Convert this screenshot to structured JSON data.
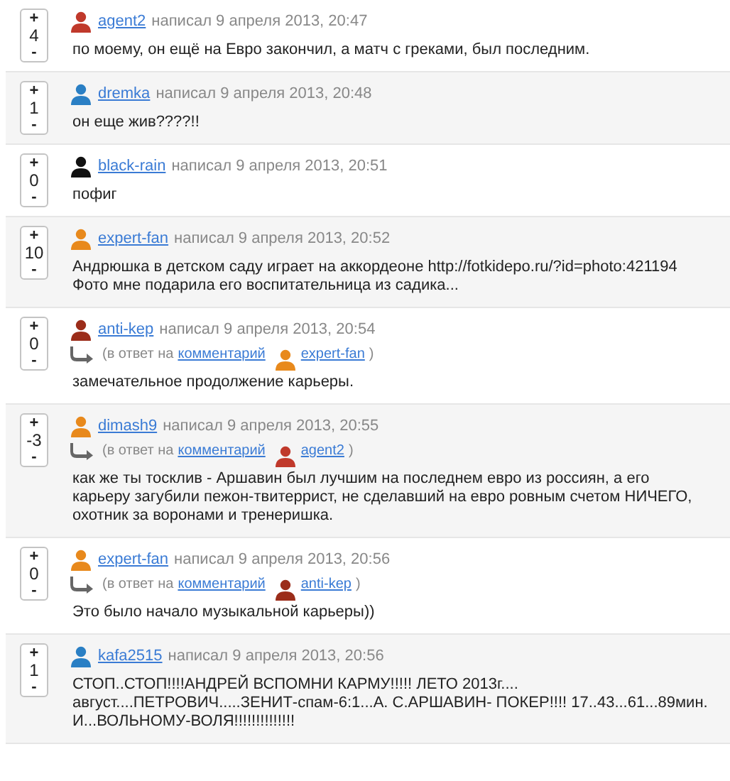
{
  "comments": [
    {
      "score": "4",
      "plus": "+",
      "minus": "-",
      "user": "agent2",
      "avatar": {
        "color": "#c0392b"
      },
      "meta": "написал 9 апреля 2013, 20:47",
      "text": "по моему, он ещё на Евро закончил, а матч с греками, был последним."
    },
    {
      "score": "1",
      "plus": "+",
      "minus": "-",
      "user": "dremka",
      "avatar": {
        "color": "#2a7fc4"
      },
      "meta": "написал 9 апреля 2013, 20:48",
      "text": "он еще жив????!!"
    },
    {
      "score": "0",
      "plus": "+",
      "minus": "-",
      "user": "black-rain",
      "avatar": {
        "color": "#111111"
      },
      "meta": "написал 9 апреля 2013, 20:51",
      "text": "пофиг"
    },
    {
      "score": "10",
      "plus": "+",
      "minus": "-",
      "user": "expert-fan",
      "avatar": {
        "color": "#e8891c"
      },
      "meta": "написал 9 апреля 2013, 20:52",
      "text": "Андрюшка в детском саду играет на аккордеоне http://fotkidepo.ru/?id=photo:421194\nФото мне подарила его воспитательница из садика..."
    },
    {
      "score": "0",
      "plus": "+",
      "minus": "-",
      "user": "anti-kep",
      "avatar": {
        "color": "#9b2d1a"
      },
      "meta": "написал 9 апреля 2013, 20:54",
      "reply": {
        "prefix": "(в ответ на",
        "link": "комментарий",
        "user": "expert-fan",
        "avatar": {
          "color": "#e8891c"
        },
        "suffix": ")"
      },
      "text": "замечательное продолжение карьеры."
    },
    {
      "score": "-3",
      "plus": "+",
      "minus": "-",
      "user": "dimash9",
      "avatar": {
        "color": "#e8891c"
      },
      "meta": "написал 9 апреля 2013, 20:55",
      "reply": {
        "prefix": "(в ответ на",
        "link": "комментарий",
        "user": "agent2",
        "avatar": {
          "color": "#c0392b"
        },
        "suffix": ")"
      },
      "text": "как же ты тосклив - Аршавин был лучшим на последнем евро из россиян, а его\nкарьеру загубили пежон-твитеррист, не сделавший на евро ровным счетом НИЧЕГО,\nохотник за воронами и тренеришка."
    },
    {
      "score": "0",
      "plus": "+",
      "minus": "-",
      "user": "expert-fan",
      "avatar": {
        "color": "#e8891c"
      },
      "meta": "написал 9 апреля 2013, 20:56",
      "reply": {
        "prefix": "(в ответ на",
        "link": "комментарий",
        "user": "anti-kep",
        "avatar": {
          "color": "#9b2d1a"
        },
        "suffix": ")"
      },
      "text": "Это было начало музыкальной карьеры))"
    },
    {
      "score": "1",
      "plus": "+",
      "minus": "-",
      "user": "kafa2515",
      "avatar": {
        "color": "#2a7fc4"
      },
      "meta": "написал 9 апреля 2013, 20:56",
      "text": "СТОП..СТОП!!!!АНДРЕЙ ВСПОМНИ КАРМУ!!!!! ЛЕТО 2013г....\nавгуст....ПЕТРОВИЧ.....ЗЕНИТ-спам-6:1...А. С.АРШАВИН- ПОКЕР!!!! 17..43...61...89мин.\nИ...ВОЛЬНОМУ-ВОЛЯ!!!!!!!!!!!!!!"
    }
  ]
}
